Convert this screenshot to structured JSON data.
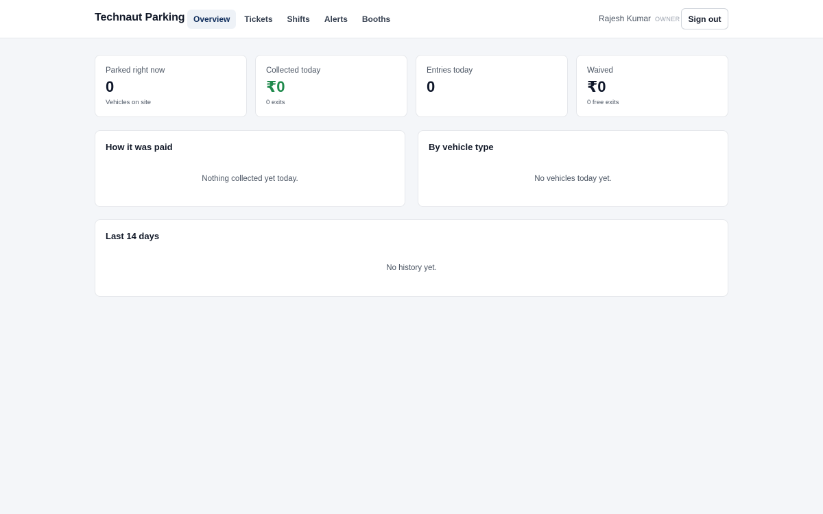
{
  "header": {
    "brand": "Technaut Parking",
    "nav": [
      {
        "label": "Overview",
        "active": true
      },
      {
        "label": "Tickets",
        "active": false
      },
      {
        "label": "Shifts",
        "active": false
      },
      {
        "label": "Alerts",
        "active": false
      },
      {
        "label": "Booths",
        "active": false
      }
    ],
    "user_name": "Rajesh Kumar",
    "user_role": "OWNER",
    "sign_out_label": "Sign out"
  },
  "stats": [
    {
      "label": "Parked right now",
      "value": "0",
      "sub": "Vehicles on site"
    },
    {
      "label": "Collected today",
      "value": "₹0",
      "sub": "0 exits"
    },
    {
      "label": "Entries today",
      "value": "0",
      "sub": ""
    },
    {
      "label": "Waived",
      "value": "₹0",
      "sub": "0 free exits"
    }
  ],
  "panels": {
    "payment": {
      "title": "How it was paid",
      "empty": "Nothing collected yet today."
    },
    "vehicle": {
      "title": "By vehicle type",
      "empty": "No vehicles today yet."
    },
    "history": {
      "title": "Last 14 days",
      "empty": "No history yet."
    }
  },
  "colors": {
    "accent_green": "#1f8a4c",
    "nav_active_bg": "#eef2f7",
    "page_bg": "#f4f6f9"
  }
}
